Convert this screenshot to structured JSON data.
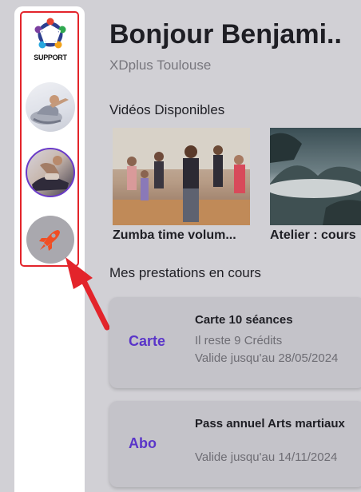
{
  "sidebar": {
    "items": [
      {
        "name": "support",
        "label": "SUPPORT",
        "icon": "support-people-logo-icon"
      },
      {
        "name": "yoga",
        "icon": "yoga-photo-avatar"
      },
      {
        "name": "fitness",
        "icon": "fitness-photo-avatar",
        "active": true
      },
      {
        "name": "rocket",
        "icon": "rocket-icon"
      }
    ],
    "highlight_color": "#e3242b"
  },
  "header": {
    "greeting": "Bonjour Benjami..",
    "club": "XDplus Toulouse"
  },
  "videos": {
    "title": "Vidéos Disponibles",
    "items": [
      {
        "title": "Zumba time volum...",
        "thumbnail": "zumba-class-photo"
      },
      {
        "title": "Atelier : cours",
        "thumbnail": "misty-mountain-photo"
      }
    ]
  },
  "prestations": {
    "title": "Mes prestations en cours",
    "items": [
      {
        "type": "Carte",
        "name": "Carte 10 séances",
        "remaining": "Il reste 9 Crédits",
        "validity": "Valide jusqu'au 28/05/2024"
      },
      {
        "type": "Abo",
        "name": "Pass annuel Arts martiaux",
        "remaining": "",
        "validity": "Valide jusqu'au 14/11/2024"
      }
    ]
  },
  "colors": {
    "accent": "#5a35c9",
    "background": "#d1d0d5",
    "card": "#c4c3c9",
    "annotation_arrow": "#e3242b"
  }
}
